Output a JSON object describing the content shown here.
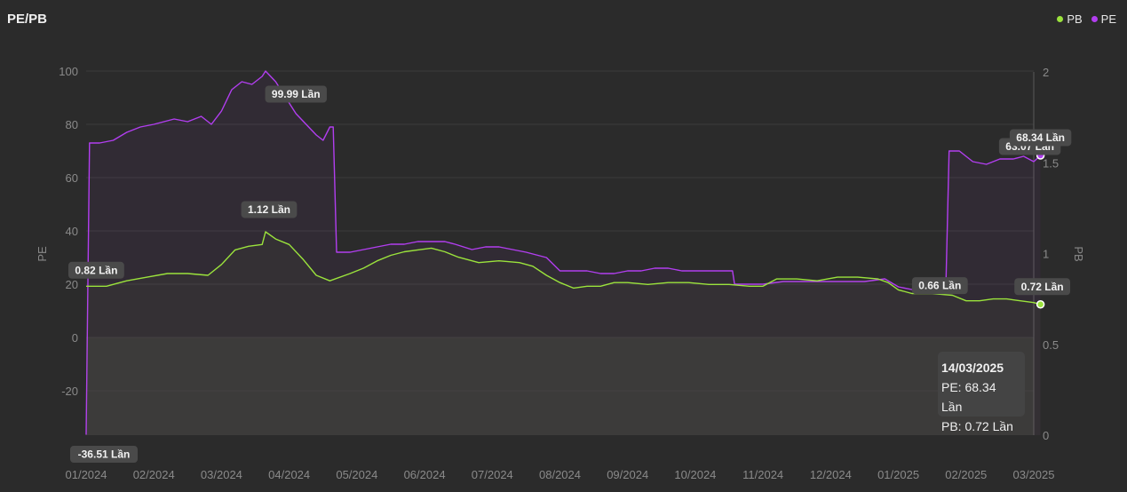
{
  "header": {
    "title": "PE/PB",
    "legend": [
      {
        "label": "PB",
        "color": "#9be33c"
      },
      {
        "label": "PE",
        "color": "#b23ef0"
      }
    ]
  },
  "tooltip": {
    "date": "14/03/2025",
    "pe": "PE: 68.34 Lần",
    "pb": "PB: 0.72 Lần"
  },
  "chart_data": {
    "type": "line",
    "title": "PE/PB",
    "x_labels": [
      "01/2024",
      "02/2024",
      "03/2024",
      "04/2024",
      "05/2024",
      "06/2024",
      "07/2024",
      "08/2024",
      "09/2024",
      "10/2024",
      "11/2024",
      "12/2024",
      "01/2025",
      "02/2025",
      "03/2025"
    ],
    "y_left": {
      "label": "PE",
      "ticks": [
        -20,
        0,
        20,
        40,
        60,
        80,
        100
      ],
      "range": [
        -36.51,
        100
      ]
    },
    "y_right": {
      "label": "PB",
      "ticks": [
        0,
        0.5,
        1,
        1.5,
        2
      ],
      "range": [
        0,
        2
      ]
    },
    "grid": true,
    "legend_position": "top-right",
    "series": [
      {
        "name": "PE",
        "axis": "left",
        "color": "#b23ef0",
        "points": [
          [
            0,
            -36.51
          ],
          [
            0.05,
            73
          ],
          [
            0.2,
            73
          ],
          [
            0.4,
            74
          ],
          [
            0.6,
            77
          ],
          [
            0.8,
            79
          ],
          [
            1.0,
            80
          ],
          [
            1.3,
            82
          ],
          [
            1.5,
            81
          ],
          [
            1.7,
            83
          ],
          [
            1.85,
            80
          ],
          [
            2.0,
            85
          ],
          [
            2.15,
            93
          ],
          [
            2.3,
            96
          ],
          [
            2.45,
            95
          ],
          [
            2.6,
            98
          ],
          [
            2.65,
            99.99
          ],
          [
            2.8,
            96
          ],
          [
            2.95,
            90
          ],
          [
            3.1,
            84
          ],
          [
            3.25,
            80
          ],
          [
            3.4,
            76
          ],
          [
            3.5,
            74
          ],
          [
            3.6,
            79
          ],
          [
            3.65,
            79
          ],
          [
            3.7,
            32
          ],
          [
            3.9,
            32
          ],
          [
            4.1,
            33
          ],
          [
            4.3,
            34
          ],
          [
            4.5,
            35
          ],
          [
            4.7,
            35
          ],
          [
            4.9,
            36
          ],
          [
            5.1,
            36
          ],
          [
            5.3,
            36
          ],
          [
            5.45,
            35
          ],
          [
            5.7,
            33
          ],
          [
            5.9,
            34
          ],
          [
            6.1,
            34
          ],
          [
            6.3,
            33
          ],
          [
            6.5,
            32
          ],
          [
            6.8,
            30
          ],
          [
            7.0,
            25
          ],
          [
            7.2,
            25
          ],
          [
            7.4,
            25
          ],
          [
            7.6,
            24
          ],
          [
            7.8,
            24
          ],
          [
            8.0,
            25
          ],
          [
            8.2,
            25
          ],
          [
            8.4,
            26
          ],
          [
            8.6,
            26
          ],
          [
            8.8,
            25
          ],
          [
            9.0,
            25
          ],
          [
            9.2,
            25
          ],
          [
            9.4,
            25
          ],
          [
            9.55,
            25
          ],
          [
            9.58,
            20
          ],
          [
            9.8,
            20
          ],
          [
            10.0,
            20
          ],
          [
            10.3,
            21
          ],
          [
            10.6,
            21
          ],
          [
            10.9,
            21
          ],
          [
            11.2,
            21
          ],
          [
            11.5,
            21
          ],
          [
            11.8,
            22
          ],
          [
            12.0,
            19
          ],
          [
            12.2,
            18
          ],
          [
            12.5,
            17
          ],
          [
            12.7,
            17
          ],
          [
            12.75,
            70
          ],
          [
            12.9,
            70
          ],
          [
            13.1,
            66
          ],
          [
            13.3,
            65
          ],
          [
            13.5,
            67
          ],
          [
            13.7,
            67
          ],
          [
            13.85,
            68
          ],
          [
            14.0,
            66
          ],
          [
            14.1,
            68.34
          ]
        ],
        "labels": [
          {
            "index": 0,
            "text": "-36.51 Lần"
          },
          {
            "index": 19,
            "text": "99.99 Lần"
          },
          {
            "index": 77,
            "text": "63.07 Lần"
          },
          {
            "index": 79,
            "text": "68.34 Lần"
          }
        ]
      },
      {
        "name": "PB",
        "axis": "right",
        "color": "#9be33c",
        "points": [
          [
            0,
            0.82
          ],
          [
            0.3,
            0.82
          ],
          [
            0.6,
            0.85
          ],
          [
            0.9,
            0.87
          ],
          [
            1.2,
            0.89
          ],
          [
            1.5,
            0.89
          ],
          [
            1.8,
            0.88
          ],
          [
            2.0,
            0.94
          ],
          [
            2.2,
            1.02
          ],
          [
            2.4,
            1.04
          ],
          [
            2.6,
            1.05
          ],
          [
            2.65,
            1.12
          ],
          [
            2.8,
            1.08
          ],
          [
            3.0,
            1.05
          ],
          [
            3.2,
            0.97
          ],
          [
            3.4,
            0.88
          ],
          [
            3.6,
            0.85
          ],
          [
            3.9,
            0.89
          ],
          [
            4.1,
            0.92
          ],
          [
            4.3,
            0.96
          ],
          [
            4.5,
            0.99
          ],
          [
            4.7,
            1.01
          ],
          [
            4.9,
            1.02
          ],
          [
            5.1,
            1.03
          ],
          [
            5.3,
            1.01
          ],
          [
            5.5,
            0.98
          ],
          [
            5.8,
            0.95
          ],
          [
            6.1,
            0.96
          ],
          [
            6.4,
            0.95
          ],
          [
            6.6,
            0.93
          ],
          [
            6.8,
            0.88
          ],
          [
            7.0,
            0.84
          ],
          [
            7.2,
            0.81
          ],
          [
            7.4,
            0.82
          ],
          [
            7.6,
            0.82
          ],
          [
            7.8,
            0.84
          ],
          [
            8.0,
            0.84
          ],
          [
            8.3,
            0.83
          ],
          [
            8.6,
            0.84
          ],
          [
            8.9,
            0.84
          ],
          [
            9.2,
            0.83
          ],
          [
            9.5,
            0.83
          ],
          [
            9.8,
            0.82
          ],
          [
            10.0,
            0.82
          ],
          [
            10.2,
            0.86
          ],
          [
            10.5,
            0.86
          ],
          [
            10.8,
            0.85
          ],
          [
            11.1,
            0.87
          ],
          [
            11.4,
            0.87
          ],
          [
            11.7,
            0.86
          ],
          [
            11.85,
            0.84
          ],
          [
            12.0,
            0.8
          ],
          [
            12.2,
            0.78
          ],
          [
            12.5,
            0.78
          ],
          [
            12.8,
            0.77
          ],
          [
            13.0,
            0.74
          ],
          [
            13.2,
            0.74
          ],
          [
            13.4,
            0.75
          ],
          [
            13.6,
            0.75
          ],
          [
            13.8,
            0.74
          ],
          [
            14.0,
            0.73
          ],
          [
            14.1,
            0.72
          ]
        ],
        "labels": [
          {
            "index": 0,
            "text": "0.82 Lần"
          },
          {
            "index": 11,
            "text": "1.12 Lần"
          },
          {
            "index": 57,
            "text": "0.66 Lần"
          },
          {
            "index": 61,
            "text": "0.72 Lần"
          }
        ]
      }
    ]
  }
}
